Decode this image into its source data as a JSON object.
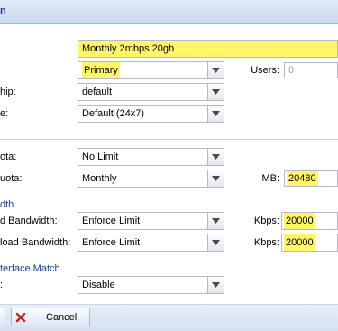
{
  "window": {
    "title_fragment": "n"
  },
  "plan": {
    "name_value": "Monthly 2mbps 20gb",
    "type_value": "Primary",
    "users_label": "Users:",
    "users_value": "0",
    "ownership_label": "hip:",
    "ownership_value": "default",
    "schedule_label": "e:",
    "schedule_value": "Default (24x7)"
  },
  "quota": {
    "total_label": "ota:",
    "total_value": "No Limit",
    "cycle_label": "uota:",
    "cycle_value": "Monthly",
    "mb_label": "MB:",
    "mb_value": "20480"
  },
  "bandwidth": {
    "section_title": "dth",
    "upload_label": "d Bandwidth:",
    "upload_value": "Enforce Limit",
    "upload_kbps_label": "Kbps:",
    "upload_kbps_value": "20000",
    "download_label": "load Bandwidth:",
    "download_value": "Enforce Limit",
    "download_kbps_label": "Kbps:",
    "download_kbps_value": "20000"
  },
  "interface": {
    "section_title": "terface Match",
    "label": ":",
    "value": "Disable"
  },
  "footer": {
    "cancel_label": "Cancel"
  },
  "colors": {
    "highlight": "#fff568",
    "header_text": "#15428b",
    "cancel_x": "#cc1f1f"
  }
}
